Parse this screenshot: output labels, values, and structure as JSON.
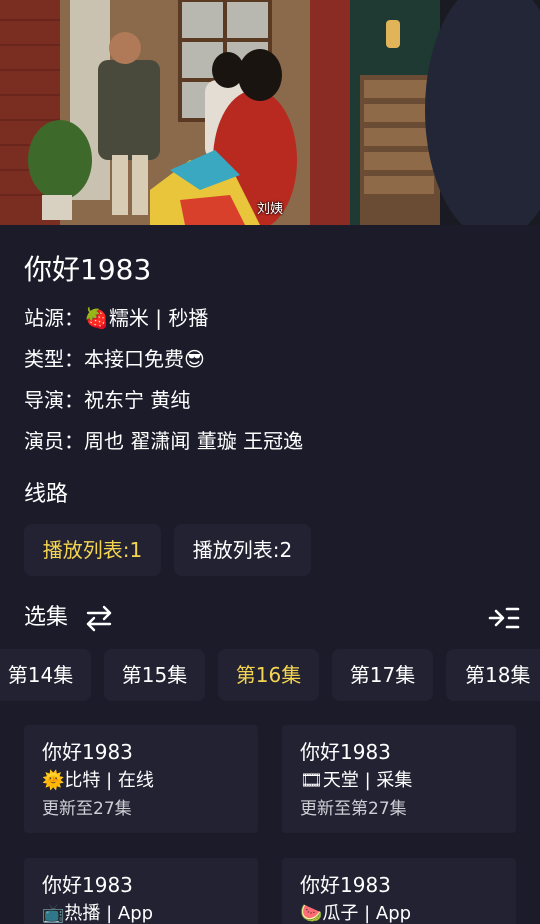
{
  "player": {
    "subtitle": "刘姨"
  },
  "detail": {
    "title": "你好1983",
    "source_label": "站源：",
    "source_value": "🍓糯米 | 秒播",
    "type_label": "类型：",
    "type_value": "本接口免费😎",
    "director_label": "导演：",
    "director_value": "祝东宁 黄纯",
    "cast_label": "演员：",
    "cast_value": "周也 翟潇闻 董璇 王冠逸"
  },
  "routes": {
    "heading": "线路",
    "items": [
      "播放列表:1",
      "播放列表:2"
    ],
    "active_index": 0
  },
  "episodes": {
    "heading": "选集",
    "items": [
      "第14集",
      "第15集",
      "第16集",
      "第17集",
      "第18集"
    ],
    "active_index": 2,
    "sort_icon": "swap-arrows-icon",
    "expand_icon": "indent-list-icon"
  },
  "sources": [
    {
      "title": "你好1983",
      "source": "🌞比特 | 在线",
      "update": "更新至27集"
    },
    {
      "title": "你好1983",
      "source": "🎞天堂 | 采集",
      "update": "更新至第27集"
    },
    {
      "title": "你好1983",
      "source": "📺热播 | App",
      "update": ""
    },
    {
      "title": "你好1983",
      "source": "🍉瓜子 | App",
      "update": ""
    }
  ],
  "colors": {
    "background": "#1c1b2a",
    "chip": "#232233",
    "accent": "#f4d552"
  }
}
